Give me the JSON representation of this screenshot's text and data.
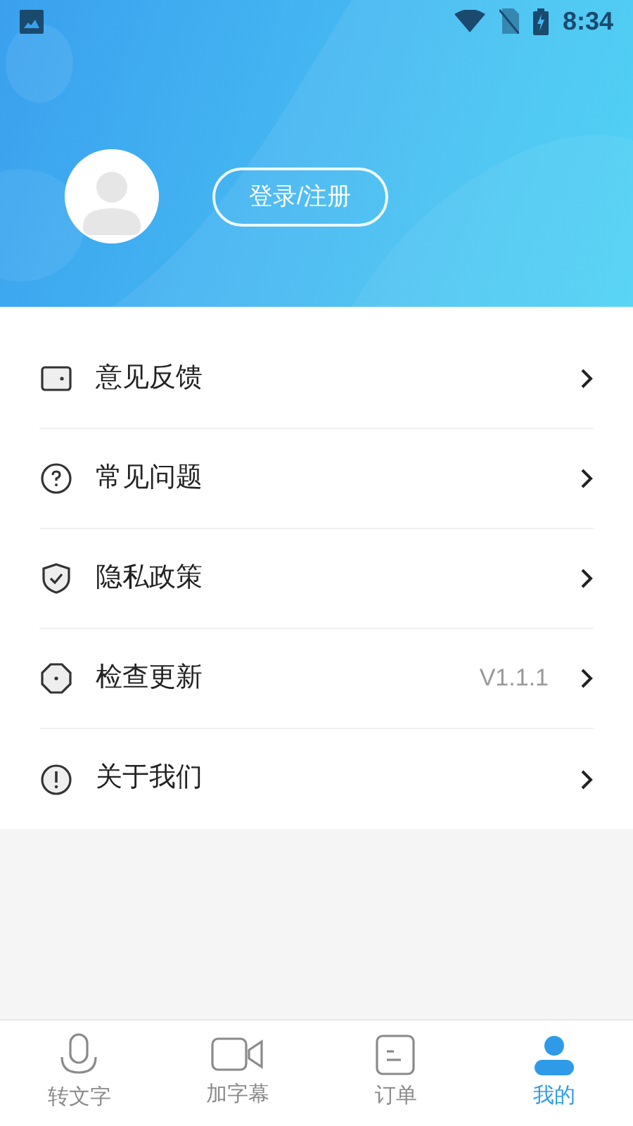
{
  "status_bar": {
    "time": "8:34"
  },
  "header": {
    "login_button": "登录/注册"
  },
  "menu": [
    {
      "kind": "feedback",
      "label": "意见反馈"
    },
    {
      "kind": "faq",
      "label": "常见问题"
    },
    {
      "kind": "privacy",
      "label": "隐私政策"
    },
    {
      "kind": "update",
      "label": "检查更新",
      "value": "V1.1.1"
    },
    {
      "kind": "about",
      "label": "关于我们"
    }
  ],
  "tabs": [
    {
      "kind": "mic",
      "label": "转文字",
      "selected": false
    },
    {
      "kind": "video",
      "label": "加字幕",
      "selected": false
    },
    {
      "kind": "order",
      "label": "订单",
      "selected": false
    },
    {
      "kind": "me",
      "label": "我的",
      "selected": true
    }
  ]
}
